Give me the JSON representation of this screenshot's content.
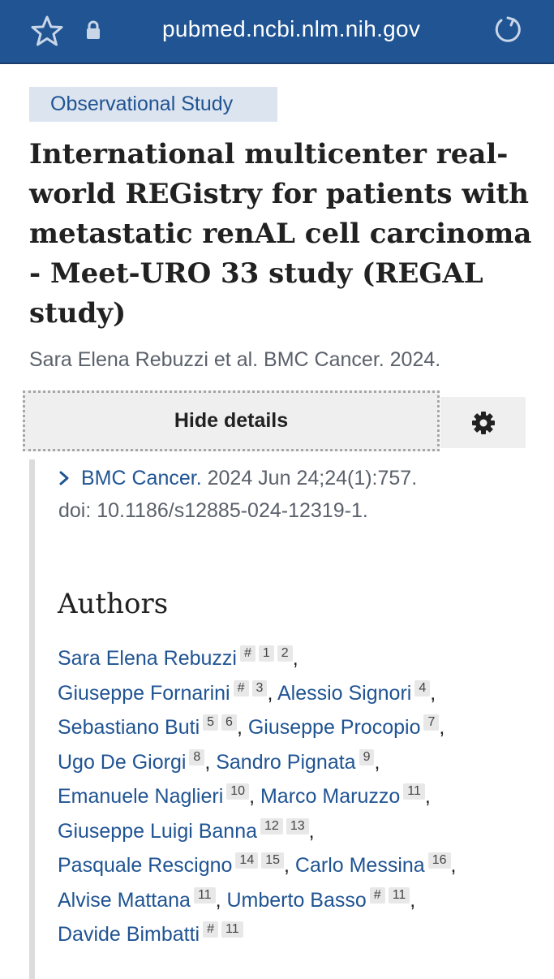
{
  "browser": {
    "url": "pubmed.ncbi.nlm.nih.gov"
  },
  "article": {
    "type_badge": "Observational Study",
    "title": "International multicenter real-world REGistry for patients with metastatic renAL cell carcinoma - Meet-URO 33 study (REGAL study)",
    "short_citation": "Sara Elena Rebuzzi et al. BMC Cancer. 2024."
  },
  "details": {
    "hide_label": "Hide details",
    "journal": "BMC Cancer.",
    "citation": "2024 Jun 24;24(1):757.",
    "doi": "doi: 10.1186/s12885-024-12319-1."
  },
  "authors_section": {
    "heading": "Authors",
    "lines": [
      [
        {
          "name": "Sara Elena Rebuzzi",
          "affs": [
            "#",
            "1",
            "2"
          ],
          "sep": ","
        }
      ],
      [
        {
          "name": "Giuseppe Fornarini",
          "affs": [
            "#",
            "3"
          ],
          "sep": ","
        },
        {
          "name": "Alessio Signori",
          "affs": [
            "4"
          ],
          "sep": ","
        }
      ],
      [
        {
          "name": "Sebastiano Buti",
          "affs": [
            "5",
            "6"
          ],
          "sep": ","
        },
        {
          "name": "Giuseppe Procopio",
          "affs": [
            "7"
          ],
          "sep": ","
        }
      ],
      [
        {
          "name": "Ugo De Giorgi",
          "affs": [
            "8"
          ],
          "sep": ","
        },
        {
          "name": "Sandro Pignata",
          "affs": [
            "9"
          ],
          "sep": ","
        }
      ],
      [
        {
          "name": "Emanuele Naglieri",
          "affs": [
            "10"
          ],
          "sep": ","
        },
        {
          "name": "Marco Maruzzo",
          "affs": [
            "11"
          ],
          "sep": ","
        }
      ],
      [
        {
          "name": "Giuseppe Luigi Banna",
          "affs": [
            "12",
            "13"
          ],
          "sep": ","
        }
      ],
      [
        {
          "name": "Pasquale Rescigno",
          "affs": [
            "14",
            "15"
          ],
          "sep": ","
        },
        {
          "name": "Carlo Messina",
          "affs": [
            "16"
          ],
          "sep": ","
        }
      ],
      [
        {
          "name": "Alvise Mattana",
          "affs": [
            "11"
          ],
          "sep": ","
        },
        {
          "name": "Umberto Basso",
          "affs": [
            "#",
            "11"
          ],
          "sep": ","
        }
      ],
      [
        {
          "name": "Davide Bimbatti",
          "affs": [
            "#",
            "11"
          ],
          "sep": ""
        }
      ]
    ]
  },
  "icons": {
    "bookmark": "star-icon",
    "secure": "lock-icon",
    "reload": "reload-icon",
    "settings": "gear-icon",
    "expand": "chevron-right-icon"
  },
  "colors": {
    "header_bg": "#205493",
    "link": "#205493",
    "badge_bg": "#dce4ef",
    "muted_text": "#5b616b"
  }
}
